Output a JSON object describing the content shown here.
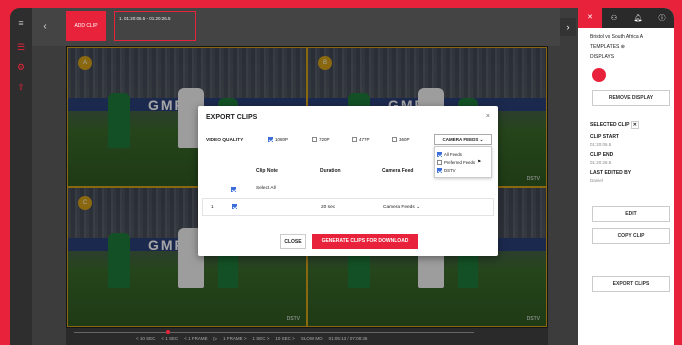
{
  "app": {
    "add_clip": "ADD CLIP",
    "clip_tab": "1. 01:20:06.5 - 01:20:26.5"
  },
  "grid": {
    "badge_a": "A",
    "badge_b": "B",
    "badge_c": "C",
    "badge_d": "D",
    "feed_label_1": "DSTV",
    "feed_label_2": "DSTV",
    "feed_label_3": "DSTV",
    "banner_text": "GMF"
  },
  "panel": {
    "match": "Bristol vs South Africa A",
    "templates": "TEMPLATES",
    "displays": "DISPLAYS",
    "remove_display": "REMOVE DISPLAY",
    "selected_clip": "SELECTED CLIP",
    "clip_start_label": "CLIP START",
    "clip_start": "01:20:06.5",
    "clip_end_label": "CLIP END",
    "clip_end": "01:20:26.5",
    "last_edited_label": "LAST EDITED BY",
    "last_edited": "Daniel",
    "edit": "EDIT",
    "copy_clip": "COPY CLIP",
    "export_clips": "EXPORT CLIPS"
  },
  "timeline": {
    "items": [
      "< 10 SEC",
      "< 1 SEC",
      "< 1 FRAME",
      "1 FRAME >",
      "1 SEC >",
      "10 SEC >",
      "SLOW MO",
      "01:05:13 / 07:08:36"
    ]
  },
  "modal": {
    "title": "EXPORT CLIPS",
    "close_x": "×",
    "video_quality": "VIDEO QUALITY",
    "q1080": "1080P",
    "q720": "720P",
    "q477": "477P",
    "q360": "360P",
    "camera_feeds_dd": "CAMERA FEEDS",
    "dd_all": "All Feeds",
    "dd_pref": "Preferred Feeds",
    "dd_dstv": "DSTV",
    "h_clip_note": "Clip Note",
    "h_duration": "Duration",
    "h_camera_feed": "Camera Feed",
    "select_all": "Select All",
    "row_num": "1",
    "row_duration": "20 sec",
    "row_camera": "Camera Feeds",
    "btn_close": "CLOSE",
    "btn_generate": "GENERATE CLIPS FOR DOWNLOAD"
  }
}
